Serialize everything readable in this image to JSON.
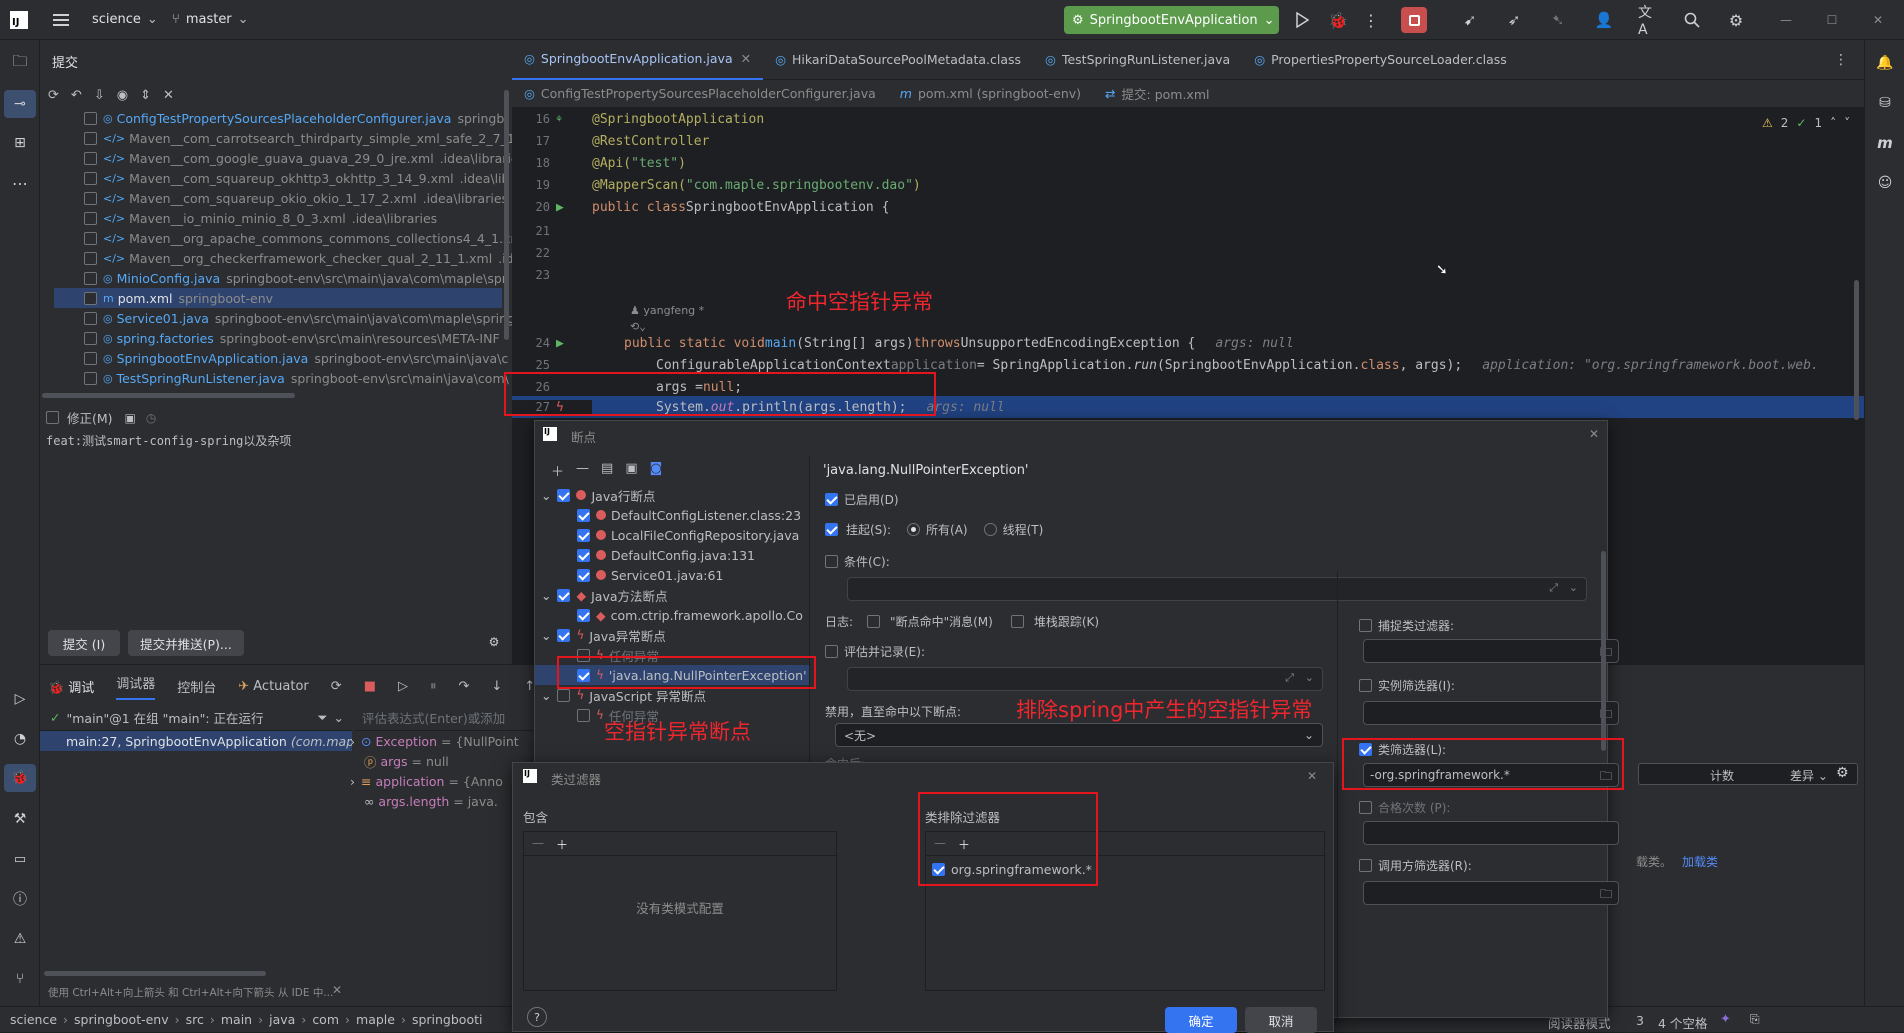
{
  "titlebar": {
    "app_logo": "IJ",
    "project": "science",
    "branch": "master",
    "run_config": "SpringbootEnvApplication",
    "icons": [
      "hamburger-menu-icon",
      "run-icon",
      "debug-icon",
      "more-icon",
      "stop-icon",
      "vcs-update-icon",
      "vcs-push-icon",
      "vcs-revert-icon",
      "account-icon",
      "translate-icon",
      "search-icon",
      "settings-icon",
      "minimize-icon",
      "maximize-icon",
      "close-icon"
    ]
  },
  "commit": {
    "title": "提交",
    "files": [
      {
        "name": "ConfigTestPropertySourcesPlaceholderConfigurer.java",
        "path": "springb",
        "color": "#56a8f5",
        "icon": "class-icon"
      },
      {
        "name": "Maven__com_carrotsearch_thirdparty_simple_xml_safe_2_7_1.xml",
        "path": "",
        "color": "#8c8c8c",
        "icon": "xml-icon"
      },
      {
        "name": "Maven__com_google_guava_guava_29_0_jre.xml",
        "path": ".idea\\libraries",
        "color": "#8c8c8c",
        "icon": "xml-icon"
      },
      {
        "name": "Maven__com_squareup_okhttp3_okhttp_3_14_9.xml",
        "path": ".idea\\lib",
        "color": "#8c8c8c",
        "icon": "xml-icon"
      },
      {
        "name": "Maven__com_squareup_okio_okio_1_17_2.xml",
        "path": ".idea\\libraries",
        "color": "#8c8c8c",
        "icon": "xml-icon"
      },
      {
        "name": "Maven__io_minio_minio_8_0_3.xml",
        "path": ".idea\\libraries",
        "color": "#8c8c8c",
        "icon": "xml-icon"
      },
      {
        "name": "Maven__org_apache_commons_commons_collections4_4_1.xml",
        "path": "",
        "color": "#8c8c8c",
        "icon": "xml-icon"
      },
      {
        "name": "Maven__org_checkerframework_checker_qual_2_11_1.xml",
        "path": ".idea",
        "color": "#8c8c8c",
        "icon": "xml-icon"
      },
      {
        "name": "MinioConfig.java",
        "path": "springboot-env\\src\\main\\java\\com\\maple\\spr",
        "color": "#56a8f5",
        "icon": "class-icon"
      },
      {
        "name": "pom.xml",
        "path": "springboot-env",
        "color": "#dfe1e5",
        "icon": "maven-icon"
      },
      {
        "name": "Service01.java",
        "path": "springboot-env\\src\\main\\java\\com\\maple\\spring",
        "color": "#56a8f5",
        "icon": "class-icon"
      },
      {
        "name": "spring.factories",
        "path": "springboot-env\\src\\main\\resources\\META-INF",
        "color": "#56a8f5",
        "icon": "factories-icon"
      },
      {
        "name": "SpringbootEnvApplication.java",
        "path": "springboot-env\\src\\main\\java\\c",
        "color": "#56a8f5",
        "icon": "class-icon"
      },
      {
        "name": "TestSpringRunListener.java",
        "path": "springboot-env\\src\\main\\java\\com\\",
        "color": "#56a8f5",
        "icon": "class-icon"
      }
    ],
    "amend_label": "修正(M)",
    "message": "feat:测试smart-config-spring以及杂项",
    "commit_button": "提交 (I)",
    "commit_push_button": "提交并推送(P)..."
  },
  "editor": {
    "tabs": [
      {
        "label": "SpringbootEnvApplication.java",
        "active": true
      },
      {
        "label": "HikariDataSourcePoolMetadata.class",
        "active": false
      },
      {
        "label": "TestSpringRunListener.java",
        "active": false
      },
      {
        "label": "PropertiesPropertySourceLoader.class",
        "active": false
      }
    ],
    "tabs2": [
      {
        "label": "ConfigTestPropertySourcesPlaceholderConfigurer.java"
      },
      {
        "label": "pom.xml (springboot-env)"
      },
      {
        "label": "提交: pom.xml"
      }
    ],
    "inspections": {
      "warnings": "2",
      "checks": "1"
    },
    "lines": {
      "l16": "16",
      "l17": "17",
      "l18": "18",
      "l19": "19",
      "l20": "20",
      "l21": "21",
      "l22": "22",
      "l23": "23",
      "l24": "24",
      "l25": "25",
      "l26": "26",
      "l27": "27",
      "ann1": "@SpringbootApplication",
      "ann2": "@RestController",
      "ann3a": "@Api(",
      "ann3b": "\"test\"",
      "ann3c": ")",
      "ann4a": "@MapperScan(",
      "ann4b": "\"com.maple.springbootenv.dao\"",
      "ann4c": ")",
      "cls_kw": "public class ",
      "cls_name": "SpringbootEnvApplication {",
      "author": "yangfeng *",
      "main_kw": "public static void ",
      "main_name": "main",
      "main_sig": "(String[] args) ",
      "throws_kw": "throws ",
      "exc": "UnsupportedEncodingException {",
      "main_hint": "args: null",
      "l25_code": "ConfigurableApplicationContext ",
      "l25_var": "application",
      "l25_mid": " = SpringApplication.",
      "l25_run": "run",
      "l25_args": "(SpringbootEnvApplication.",
      "l25_class_kw": "class",
      "l25_end": ", args);",
      "l25_hint": "application: \"org.springframework.boot.web.",
      "l26_code": "args = ",
      "l26_null": "null",
      "l26_semi": ";",
      "l27_a": "System.",
      "l27_out": "out",
      "l27_b": ".println(args.length);",
      "l27_hint": "args: null"
    }
  },
  "annotations": {
    "npe_hit": "命中空指针异常",
    "exclude_spring": "排除spring中产生的空指针异常",
    "npe_breakpoint": "空指针异常断点"
  },
  "breakpoints": {
    "title": "断点",
    "tree": [
      {
        "label": "Java行断点",
        "level": 0,
        "type": "group"
      },
      {
        "label": "DefaultConfigListener.class:23",
        "level": 1,
        "type": "line"
      },
      {
        "label": "LocalFileConfigRepository.java",
        "level": 1,
        "type": "line"
      },
      {
        "label": "DefaultConfig.java:131",
        "level": 1,
        "type": "line"
      },
      {
        "label": "Service01.java:61",
        "level": 1,
        "type": "line"
      },
      {
        "label": "Java方法断点",
        "level": 0,
        "type": "group-method"
      },
      {
        "label": "com.ctrip.framework.apollo.Co",
        "level": 1,
        "type": "method"
      },
      {
        "label": "Java异常断点",
        "level": 0,
        "type": "group-exc"
      },
      {
        "label": "任何异常",
        "level": 1,
        "type": "exc-off"
      },
      {
        "label": "'java.lang.NullPointerException'",
        "level": 1,
        "type": "exc",
        "selected": true
      },
      {
        "label": "JavaScript 异常断点",
        "level": 0,
        "type": "group-js"
      },
      {
        "label": "任何异常",
        "level": 1,
        "type": "exc-off"
      }
    ],
    "heading": "'java.lang.NullPointerException'",
    "enabled": "已启用(D)",
    "suspend": "挂起(S):",
    "all": "所有(A)",
    "thread": "线程(T)",
    "condition": "条件(C):",
    "log": "日志:",
    "log_msg": "\"断点命中\"消息(M)",
    "stack": "堆栈跟踪(K)",
    "eval_log": "评估并记录(E):",
    "disable_until": "禁用，直至命中以下断点:",
    "none": "<无>",
    "after_hit": "命中后:",
    "catch_filter": "捕捉类过滤器:",
    "instance_filter": "实例筛选器(I):",
    "class_filter": "类筛选器(L):",
    "class_filter_value": "-org.springframework.*",
    "pass_count": "合格次数 (P):",
    "caller_filter": "调用方筛选器(R):"
  },
  "class_filter_dialog": {
    "title": "类过滤器",
    "include": "包含",
    "exclude": "类排除过滤器",
    "empty": "没有类模式配置",
    "exclude_item": "org.springframework.*",
    "ok": "确定",
    "cancel": "取消"
  },
  "debug": {
    "tabs": [
      "调试",
      "调试器",
      "控制台",
      "Actuator"
    ],
    "thread": "\"main\"@1 在组 \"main\": 正在运行",
    "frame": "main:27, SpringbootEnvApplication",
    "frame_pkg": "(com.mapl",
    "eval_placeholder": "评估表达式(Enter)或添加",
    "vars": [
      {
        "name": "Exception",
        "value": "= {NullPoint",
        "icon": "exception-icon"
      },
      {
        "name": "args",
        "value": "= null",
        "icon": "param-icon"
      },
      {
        "name": "application",
        "value": "= {Anno",
        "icon": "var-icon"
      },
      {
        "name": "args.length",
        "value": "= java.",
        "icon": "watch-icon"
      }
    ],
    "hint": "使用 Ctrl+Alt+向上箭头 和 Ctrl+Alt+向下箭头 从 IDE 中...",
    "right_cols": [
      "计数",
      "差异"
    ],
    "load_classes": "加载类",
    "classes_label": "载类。"
  },
  "statusbar": {
    "crumbs": [
      "science",
      "springboot-env",
      "src",
      "main",
      "java",
      "com",
      "maple",
      "springbooti"
    ],
    "reader_mode": "阅读器模式",
    "indent": "4 个空格",
    "position": "3"
  }
}
